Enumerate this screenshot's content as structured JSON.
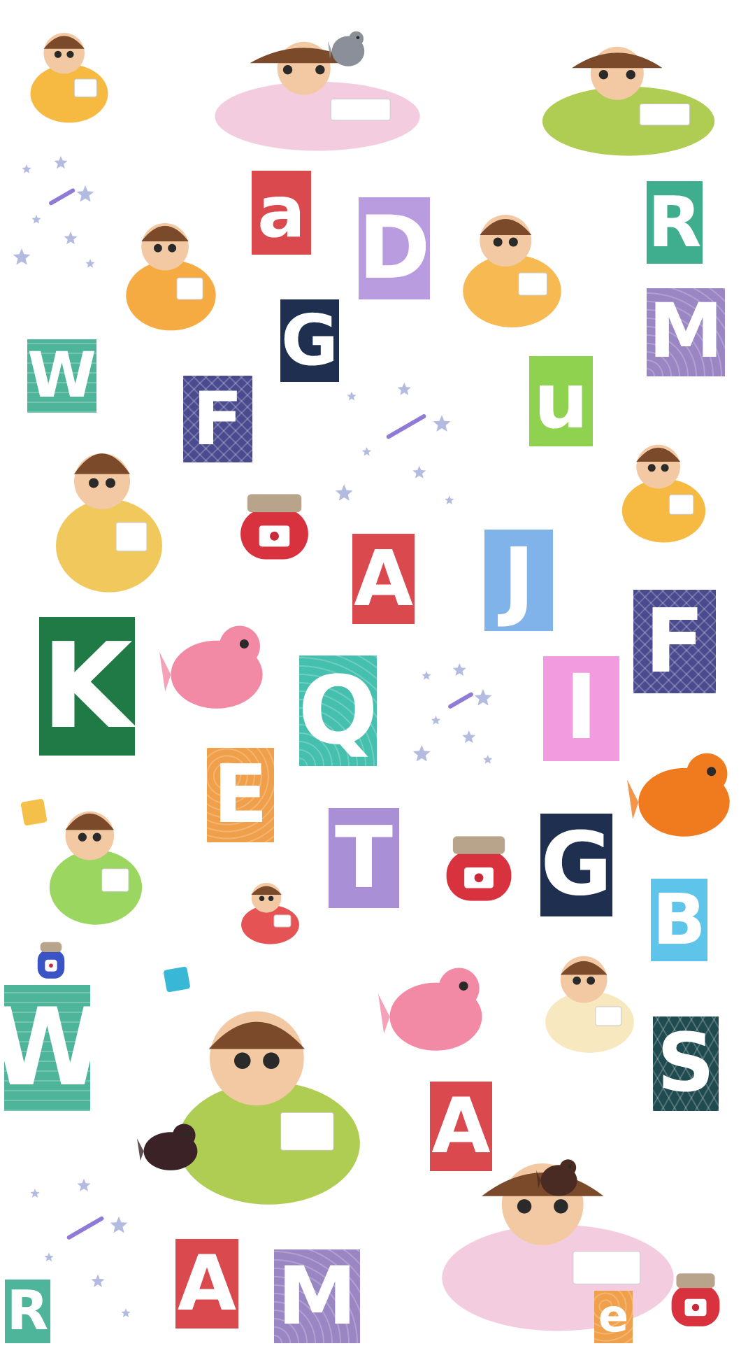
{
  "tiles": [
    {
      "letter": "a",
      "color": "#d9494e",
      "pattern": "dots"
    },
    {
      "letter": "D",
      "color": "#b99be0",
      "pattern": "plain"
    },
    {
      "letter": "R",
      "color": "#3fae8f",
      "pattern": "scales"
    },
    {
      "letter": "G",
      "color": "#1f2f4f",
      "pattern": "plain"
    },
    {
      "letter": "M",
      "color": "#9b86c4",
      "pattern": "waves"
    },
    {
      "letter": "W",
      "color": "#4fb59a",
      "pattern": "lines"
    },
    {
      "letter": "F",
      "color": "#4a4a8f",
      "pattern": "zigzag"
    },
    {
      "letter": "u",
      "color": "#8fd24f",
      "pattern": "plain"
    },
    {
      "letter": "A",
      "color": "#d9494e",
      "pattern": "dots"
    },
    {
      "letter": "J",
      "color": "#7fb3ea",
      "pattern": "clouds"
    },
    {
      "letter": "F",
      "color": "#4a4a8f",
      "pattern": "zigzag"
    },
    {
      "letter": "K",
      "color": "#1f7a45",
      "pattern": "flowers"
    },
    {
      "letter": "Q",
      "color": "#45bfae",
      "pattern": "waves"
    },
    {
      "letter": "I",
      "color": "#f29bde",
      "pattern": "hearts"
    },
    {
      "letter": "E",
      "color": "#f0a04a",
      "pattern": "swirls"
    },
    {
      "letter": "T",
      "color": "#a98fd6",
      "pattern": "triangles"
    },
    {
      "letter": "G",
      "color": "#1f2f4f",
      "pattern": "plain"
    },
    {
      "letter": "B",
      "color": "#5fc4ea",
      "pattern": "plain"
    },
    {
      "letter": "W",
      "color": "#4fb59a",
      "pattern": "lines"
    },
    {
      "letter": "S",
      "color": "#1f4a4f",
      "pattern": "leaves"
    },
    {
      "letter": "A",
      "color": "#d9494e",
      "pattern": "dots"
    },
    {
      "letter": "A",
      "color": "#d9494e",
      "pattern": "dots"
    },
    {
      "letter": "M",
      "color": "#9b86c4",
      "pattern": "waves"
    },
    {
      "letter": "R",
      "color": "#4fb59a",
      "pattern": "scales"
    },
    {
      "letter": "e",
      "color": "#f0a04a",
      "pattern": "swirls"
    }
  ],
  "decorations": [
    {
      "icon": "girl-drawing-icon",
      "color": "#f5b12e"
    },
    {
      "icon": "girl-reading-on-unicorn-icon",
      "color": "#f2c8dc"
    },
    {
      "icon": "grey-cat-icon",
      "color": "#8a8f9a"
    },
    {
      "icon": "boy-reading-on-dinosaur-icon",
      "color": "#a6c640"
    },
    {
      "icon": "boy-drawing-icon",
      "color": "#f5a22e"
    },
    {
      "icon": "girl-reading-book-icon",
      "color": "#f6b340"
    },
    {
      "icon": "girl-sitting-books-icon",
      "color": "#f0c24a"
    },
    {
      "icon": "girl-reading-abc-icon",
      "color": "#f5b12e"
    },
    {
      "icon": "cherry-jam-jar-icon",
      "color": "#d9323f"
    },
    {
      "icon": "pink-fish-icon",
      "color": "#f28aa6"
    },
    {
      "icon": "orange-fox-icon",
      "color": "#f07a1e"
    },
    {
      "icon": "girl-reading-blue-book-icon",
      "color": "#8fd24f"
    },
    {
      "icon": "boy-behind-red-book-icon",
      "color": "#e24043"
    },
    {
      "icon": "cherry-jam-jar-icon",
      "color": "#d9323f"
    },
    {
      "icon": "pink-fish-icon",
      "color": "#f28aa6"
    },
    {
      "icon": "boy-reading-sun-book-icon",
      "color": "#f6e6b8"
    },
    {
      "icon": "magnifier-icon",
      "color": "#3a54c6"
    },
    {
      "icon": "green-dragon-with-child-icon",
      "color": "#a6c640"
    },
    {
      "icon": "black-cat-icon",
      "color": "#3a2226"
    },
    {
      "icon": "girl-reading-on-unicorn-icon",
      "color": "#f2c8dc"
    },
    {
      "icon": "brown-cat-icon",
      "color": "#4a2b24"
    },
    {
      "icon": "cherry-jam-jar-icon",
      "color": "#d9323f"
    },
    {
      "icon": "stars-and-pencils-icon",
      "color": "#9aa6d6"
    },
    {
      "icon": "stars-and-pencils-icon",
      "color": "#9aa6d6"
    },
    {
      "icon": "stars-and-pencils-icon",
      "color": "#9aa6d6"
    },
    {
      "icon": "stars-and-pencils-icon",
      "color": "#9aa6d6"
    },
    {
      "icon": "letter-block-c-icon",
      "color": "#f5c04a"
    },
    {
      "icon": "letter-block-p-icon",
      "color": "#38b7d6"
    }
  ]
}
